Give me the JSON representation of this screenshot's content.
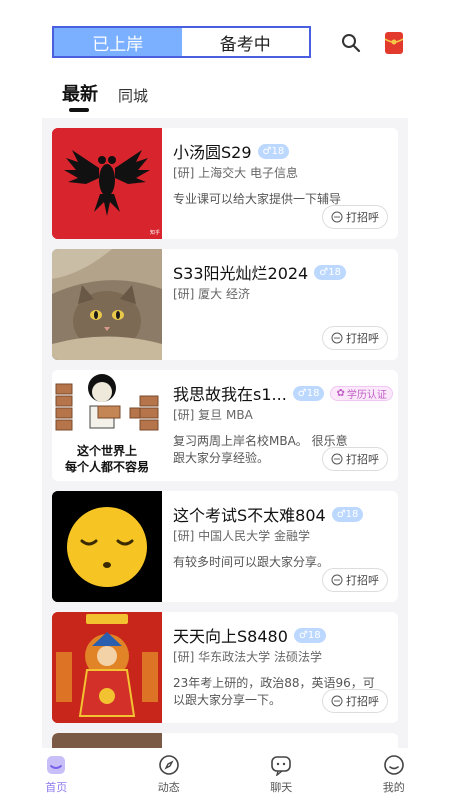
{
  "header": {
    "segments": [
      "已上岸",
      "备考中"
    ],
    "active_segment": 0
  },
  "tabs": [
    "最新",
    "同城"
  ],
  "feed": [
    {
      "name": "小汤圆S29",
      "gender_badge": "♂18",
      "meta": "[研] 上海交大 电子信息",
      "desc": "专业课可以给大家提供一下辅导",
      "cta": "打招呼",
      "thumb": "albania-flag"
    },
    {
      "name": "S33阳光灿烂2024",
      "gender_badge": "♂18",
      "meta": "[研] 厦大 经济",
      "desc": "",
      "cta": "打招呼",
      "thumb": "cat-under-blanket"
    },
    {
      "name": "我思故我在s1...",
      "gender_badge": "♂18",
      "cert_badge": "学历认证",
      "meta": "[研] 复旦 MBA",
      "desc": "复习两周上岸名校MBA。 很乐意跟大家分享经验。",
      "cta": "打招呼",
      "thumb": "meme-panda",
      "thumb_caption": [
        "这个世界上",
        "每个人都不容易"
      ]
    },
    {
      "name": "这个考试S不太难804",
      "gender_badge": "♂18",
      "meta": "[研] 中国人民大学 金融学",
      "desc": "有较多时间可以跟大家分享。",
      "cta": "打招呼",
      "thumb": "sleepy-emoji"
    },
    {
      "name": "天天向上S8480",
      "gender_badge": "♂18",
      "meta": "[研] 华东政法大学 法硕法学",
      "desc": "23年考上研的，政治88，英语96，可以跟大家分享一下。",
      "cta": "打招呼",
      "thumb": "caishen-poster"
    }
  ],
  "bottom_nav": [
    {
      "label": "首页",
      "icon": "home-icon",
      "active": true
    },
    {
      "label": "动态",
      "icon": "compass-icon",
      "active": false
    },
    {
      "label": "聊天",
      "icon": "chat-icon",
      "active": false
    },
    {
      "label": "我的",
      "icon": "profile-icon",
      "active": false
    }
  ],
  "colors": {
    "segment_active": "#7ab0ff",
    "segment_border": "#4a5fe0",
    "badge": "#bcd8ff",
    "nav_active": "#8e7cf0",
    "feed_bg": "#f4f4f6"
  }
}
